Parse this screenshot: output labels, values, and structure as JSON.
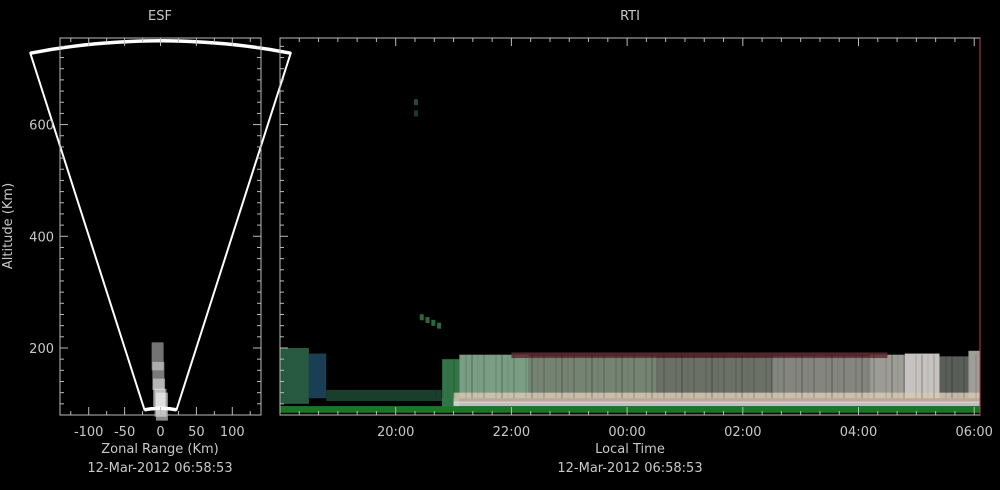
{
  "colors": {
    "background": "#000000",
    "text": "#c8c8c8",
    "axis": "#bbbbbb",
    "fan": "#ffffff",
    "right_edge": "#c04048"
  },
  "chart_data": [
    {
      "type": "heatmap",
      "title": "ESF",
      "xlabel": "Zonal Range (Km)",
      "ylabel": "Altitude (Km)",
      "timestamp": "12-Mar-2012 06:58:53",
      "xlim": [
        -140,
        140
      ],
      "ylim": [
        80,
        755
      ],
      "x_ticks": [
        -100,
        -50,
        0,
        50,
        100
      ],
      "x_tick_labels": [
        "-100",
        "-50",
        "0",
        "50",
        "100"
      ],
      "y_ticks": [
        200,
        400,
        600
      ],
      "y_tick_labels": [
        "200",
        "400",
        "600"
      ],
      "fan": {
        "half_angle_deg": 14,
        "r_min": 92,
        "r_max": 750
      },
      "echoes": [
        {
          "x": -4,
          "y": 185,
          "intensity": 0.6
        },
        {
          "x": -3,
          "y": 150,
          "intensity": 0.7
        },
        {
          "x": -2,
          "y": 120,
          "intensity": 0.8
        },
        {
          "x": 0,
          "y": 102,
          "intensity": 0.9
        },
        {
          "x": 2,
          "y": 95,
          "intensity": 0.95
        }
      ]
    },
    {
      "type": "heatmap",
      "title": "RTI",
      "xlabel": "Local Time",
      "timestamp": "12-Mar-2012 06:58:53",
      "xlim": [
        18.0,
        30.1
      ],
      "ylim": [
        80,
        755
      ],
      "x_ticks": [
        20,
        22,
        24,
        26,
        28,
        30
      ],
      "x_tick_labels": [
        "20:00",
        "22:00",
        "00:00",
        "02:00",
        "04:00",
        "06:00"
      ],
      "y_ticks": [
        200,
        400,
        600
      ],
      "bands": [
        {
          "t0": 18.0,
          "t1": 18.5,
          "y0": 100,
          "y1": 200,
          "color": "#2f6a4c"
        },
        {
          "t0": 18.5,
          "t1": 18.8,
          "y0": 110,
          "y1": 190,
          "color": "#1e4a64"
        },
        {
          "t0": 18.8,
          "t1": 20.8,
          "y0": 105,
          "y1": 125,
          "color": "#1d4a34"
        },
        {
          "t0": 20.8,
          "t1": 21.1,
          "y0": 95,
          "y1": 180,
          "color": "#3a8a52"
        },
        {
          "t0": 21.1,
          "t1": 22.3,
          "y0": 110,
          "y1": 188,
          "color": "#8fb89a"
        },
        {
          "t0": 22.3,
          "t1": 24.5,
          "y0": 110,
          "y1": 185,
          "color": "#8a9a86"
        },
        {
          "t0": 24.5,
          "t1": 26.5,
          "y0": 110,
          "y1": 183,
          "color": "#7e8478"
        },
        {
          "t0": 26.5,
          "t1": 28.2,
          "y0": 110,
          "y1": 185,
          "color": "#9a9c94"
        },
        {
          "t0": 28.2,
          "t1": 28.8,
          "y0": 110,
          "y1": 188,
          "color": "#b8b8b0"
        },
        {
          "t0": 28.8,
          "t1": 29.4,
          "y0": 110,
          "y1": 190,
          "color": "#e8e4e0"
        },
        {
          "t0": 29.4,
          "t1": 29.9,
          "y0": 110,
          "y1": 185,
          "color": "#6a6e68"
        },
        {
          "t0": 29.9,
          "t1": 30.1,
          "y0": 110,
          "y1": 195,
          "color": "#b8b8b4"
        },
        {
          "t0": 21.0,
          "t1": 30.1,
          "y0": 102,
          "y1": 120,
          "color": "#d8c8b4"
        },
        {
          "t0": 18.0,
          "t1": 30.1,
          "y0": 84,
          "y1": 96,
          "color": "#1f8a2a"
        },
        {
          "t0": 21.0,
          "t1": 30.1,
          "y0": 96,
          "y1": 104,
          "color": "#e0e0e0"
        },
        {
          "t0": 22.0,
          "t1": 28.5,
          "y0": 182,
          "y1": 192,
          "color": "#5e2e34"
        }
      ],
      "spots": [
        {
          "t": 20.35,
          "y": 640,
          "color": "#2a4a34"
        },
        {
          "t": 20.35,
          "y": 620,
          "color": "#1e3a28"
        },
        {
          "t": 20.45,
          "y": 255,
          "color": "#2a6a38"
        },
        {
          "t": 20.55,
          "y": 250,
          "color": "#2a6a38"
        },
        {
          "t": 20.65,
          "y": 245,
          "color": "#2a6a38"
        },
        {
          "t": 20.75,
          "y": 240,
          "color": "#2a6a38"
        }
      ]
    }
  ]
}
